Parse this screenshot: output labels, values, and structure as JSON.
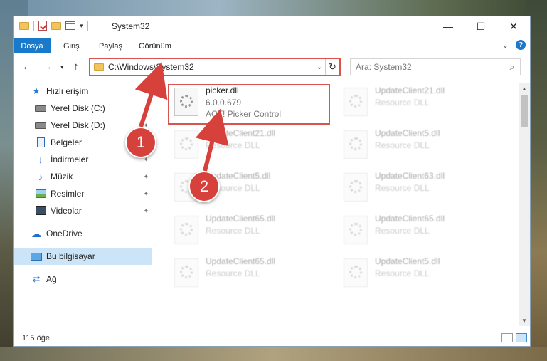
{
  "window": {
    "title": "System32"
  },
  "window_controls": {
    "minimize": "—",
    "maximize": "☐",
    "close": "✕"
  },
  "ribbon": {
    "tabs": [
      {
        "label": "Dosya",
        "active": true
      },
      {
        "label": "Giriş"
      },
      {
        "label": "Paylaş"
      },
      {
        "label": "Görünüm"
      }
    ],
    "expand": "⌄",
    "help": "?"
  },
  "address_bar": {
    "path": "C:\\Windows\\System32",
    "refresh": "↻",
    "dropdown": "⌄"
  },
  "search": {
    "placeholder": "Ara: System32",
    "icon": "⌕"
  },
  "sidebar": {
    "items": [
      {
        "label": "Hızlı erişim",
        "icon": "star-icon"
      },
      {
        "label": "Yerel Disk (C:)",
        "icon": "disk-icon",
        "pinned": true
      },
      {
        "label": "Yerel Disk (D:)",
        "icon": "disk-icon",
        "pinned": true
      },
      {
        "label": "Belgeler",
        "icon": "document-icon",
        "pinned": true
      },
      {
        "label": "İndirmeler",
        "icon": "download-icon",
        "pinned": true
      },
      {
        "label": "Müzik",
        "icon": "music-icon",
        "pinned": true
      },
      {
        "label": "Resimler",
        "icon": "pictures-icon",
        "pinned": true
      },
      {
        "label": "Videolar",
        "icon": "videos-icon",
        "pinned": true
      },
      {
        "label": "OneDrive",
        "icon": "cloud-icon"
      },
      {
        "label": "Bu bilgisayar",
        "icon": "computer-icon",
        "selected": true
      },
      {
        "label": "Ağ",
        "icon": "network-icon"
      }
    ]
  },
  "files": [
    {
      "name": "picker.dll",
      "line2": "6.0.0.679",
      "line3": "ACT! Picker Control",
      "highlighted": true
    },
    {
      "name": "UpdateClient21.dll",
      "line2": "Resource DLL"
    },
    {
      "name": "UpdateClient21.dll",
      "line2": "Resource DLL"
    },
    {
      "name": "UpdateClient5.dll",
      "line2": "Resource DLL"
    },
    {
      "name": "UpdateClient5.dll",
      "line2": "Resource DLL"
    },
    {
      "name": "UpdateClient63.dll",
      "line2": "Resource DLL"
    },
    {
      "name": "UpdateClient65.dll",
      "line2": "Resource DLL"
    },
    {
      "name": "UpdateClient65.dll",
      "line2": "Resource DLL"
    },
    {
      "name": "UpdateClient65.dll",
      "line2": "Resource DLL"
    },
    {
      "name": "UpdateClient5.dll",
      "line2": "Resource DLL"
    }
  ],
  "status": {
    "count": "115 öğe"
  },
  "annotations": {
    "marker1": "1",
    "marker2": "2"
  },
  "colors": {
    "accent": "#1979ca",
    "highlight": "#d9534f",
    "marker": "#d7413b"
  }
}
